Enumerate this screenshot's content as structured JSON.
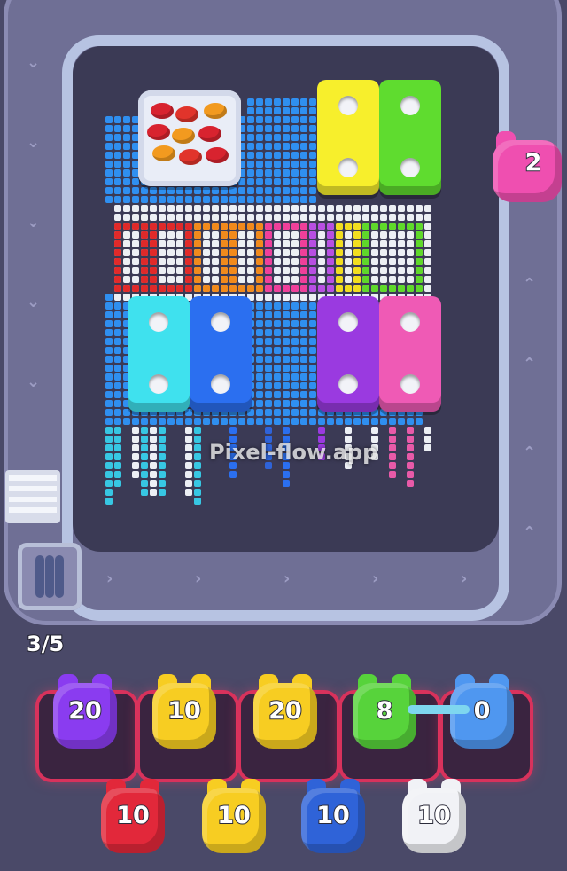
{
  "watermark": "Pixel-flow.app",
  "track": {
    "queue_counter": "3/5"
  },
  "board": {
    "banner_text": "DOREMiA",
    "blocks": [
      {
        "name": "yellow-block",
        "color": "#f7ef2c"
      },
      {
        "name": "green-block",
        "color": "#5fdc2f"
      },
      {
        "name": "cyan-block",
        "color": "#3fe1ee"
      },
      {
        "name": "blue-block",
        "color": "#2b6ff0"
      },
      {
        "name": "purple-block",
        "color": "#9a3ae0"
      },
      {
        "name": "pink-block",
        "color": "#ef5ab5"
      }
    ]
  },
  "pigs_on_track": [
    {
      "color": "#ef4fb0",
      "label": "2"
    }
  ],
  "pig_slots": [
    {
      "color": "#8a3cf0",
      "label": "20"
    },
    {
      "color": "#f7cd22",
      "label": "10"
    },
    {
      "color": "#f7cd22",
      "label": "20"
    },
    {
      "color": "#57d33b",
      "label": "8"
    },
    {
      "color": "#4f97f0",
      "label": "0"
    }
  ],
  "pig_queue": [
    {
      "color": "#e2283a",
      "label": "10"
    },
    {
      "color": "#f7cd22",
      "label": "10"
    },
    {
      "color": "#2f63d8",
      "label": "10"
    },
    {
      "color": "#f1f2f6",
      "label": "10"
    }
  ],
  "colors": {
    "track": "#6f6f95",
    "rail": "#b7c3e2",
    "board": "#3b3a55",
    "pixel_blue": "#2f8ff0",
    "pixel_white": "#eceff4"
  }
}
